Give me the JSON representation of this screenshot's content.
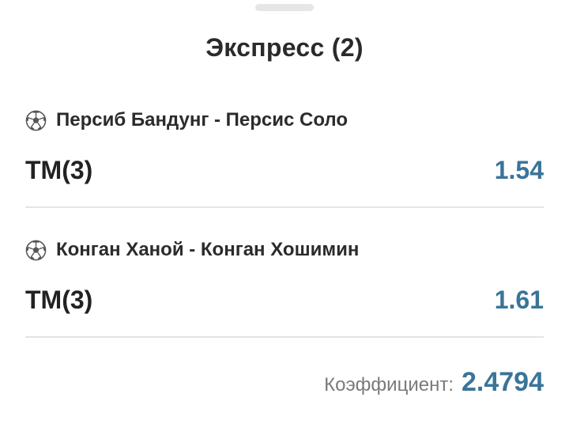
{
  "header": {
    "title": "Экспресс (2)"
  },
  "bets": [
    {
      "sport_icon": "soccer-ball-icon",
      "match": "Персиб Бандунг - Персис Соло",
      "outcome": "ТМ(3)",
      "odd": "1.54"
    },
    {
      "sport_icon": "soccer-ball-icon",
      "match": "Конган Ханой - Конган Хошимин",
      "outcome": "ТМ(3)",
      "odd": "1.61"
    }
  ],
  "summary": {
    "label": "Коэффициент:",
    "value": "2.4794"
  },
  "colors": {
    "accent": "#3a7499",
    "text": "#222222",
    "muted": "#7a7a7a",
    "divider": "#e4e4e4"
  }
}
